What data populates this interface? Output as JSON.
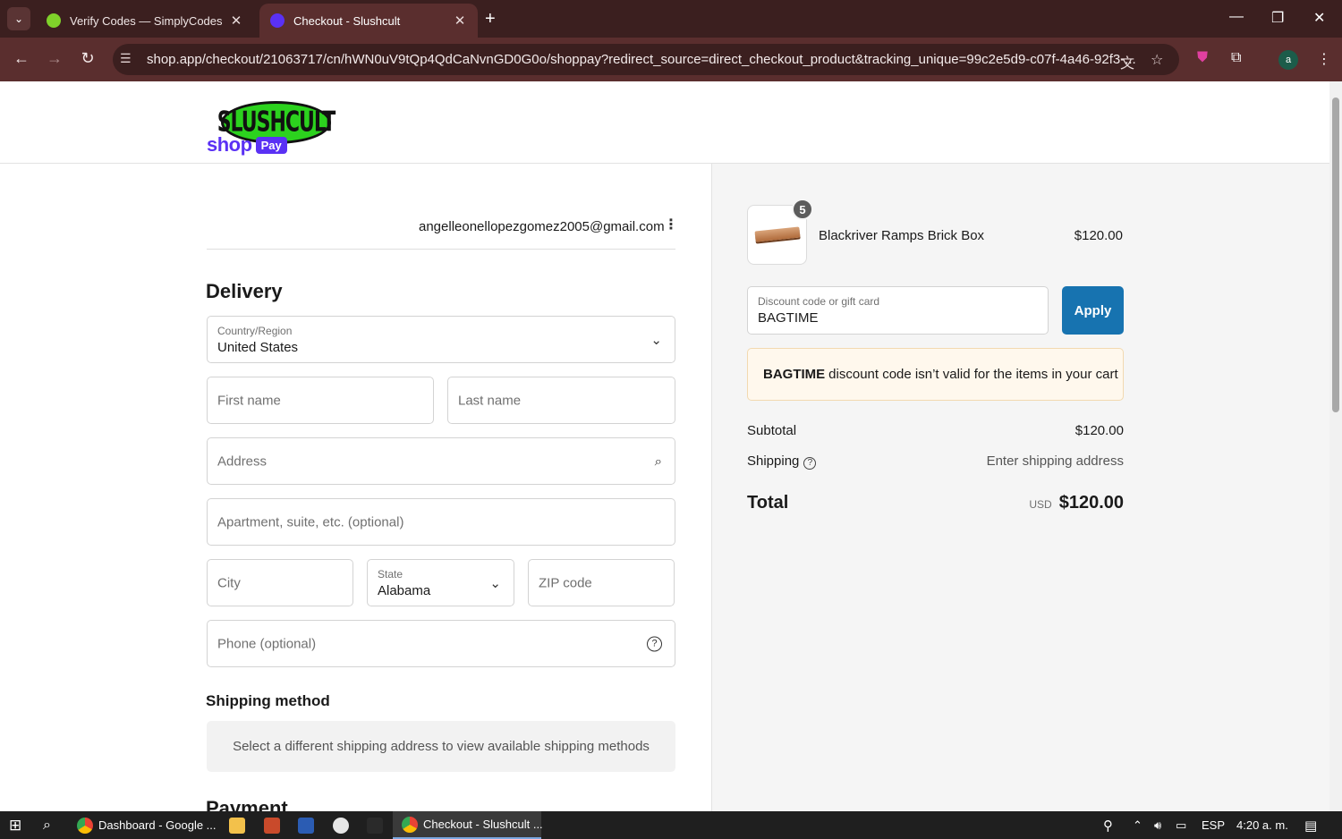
{
  "browser": {
    "tabs": [
      {
        "title": "Verify Codes — SimplyCodes",
        "active": false
      },
      {
        "title": "Checkout - Slushcult",
        "active": true
      }
    ],
    "url": "shop.app/checkout/21063717/cn/hWN0uV9tQp4QdCaNvnGD0G0o/shoppay?redirect_source=direct_checkout_product&tracking_unique=99c2e5d9-c07f-4a46-92f3-...",
    "profile_initial": "a"
  },
  "store": {
    "logo_text": "SLUSHCULT"
  },
  "shop_pay": {
    "brand": "shop",
    "pay_badge": "Pay",
    "email": "angelleonellopezgomez2005@gmail.com"
  },
  "delivery": {
    "heading": "Delivery",
    "country": {
      "label": "Country/Region",
      "value": "United States"
    },
    "first_name": {
      "placeholder": "First name"
    },
    "last_name": {
      "placeholder": "Last name"
    },
    "address": {
      "placeholder": "Address"
    },
    "apartment": {
      "placeholder": "Apartment, suite, etc. (optional)"
    },
    "city": {
      "placeholder": "City"
    },
    "state": {
      "label": "State",
      "value": "Alabama"
    },
    "zip": {
      "placeholder": "ZIP code"
    },
    "phone": {
      "placeholder": "Phone (optional)"
    }
  },
  "shipping_method": {
    "heading": "Shipping method",
    "message": "Select a different shipping address to view available shipping methods"
  },
  "next_section_cutoff": "Payment",
  "summary": {
    "product": {
      "name": "Blackriver Ramps Brick Box",
      "price": "$120.00",
      "quantity": "5"
    },
    "discount": {
      "label": "Discount code or gift card",
      "value": "BAGTIME",
      "apply_label": "Apply"
    },
    "alert": {
      "code": "BAGTIME",
      "message": "discount code isn’t valid for the items in your cart"
    },
    "subtotal": {
      "label": "Subtotal",
      "value": "$120.00"
    },
    "shipping": {
      "label": "Shipping",
      "value": "Enter shipping address"
    },
    "total": {
      "label": "Total",
      "currency": "USD",
      "value": "$120.00"
    }
  },
  "taskbar": {
    "items": [
      {
        "label": "Dashboard - Google ..."
      },
      {
        "label": "Checkout - Slushcult ..."
      }
    ],
    "language": "ESP",
    "time": "4:20 a. m."
  },
  "colors": {
    "shop_purple": "#5a31f4",
    "apply_blue": "#1773b0",
    "alert_bg": "#fff8ed",
    "chrome_bg": "#3b1f1f"
  }
}
